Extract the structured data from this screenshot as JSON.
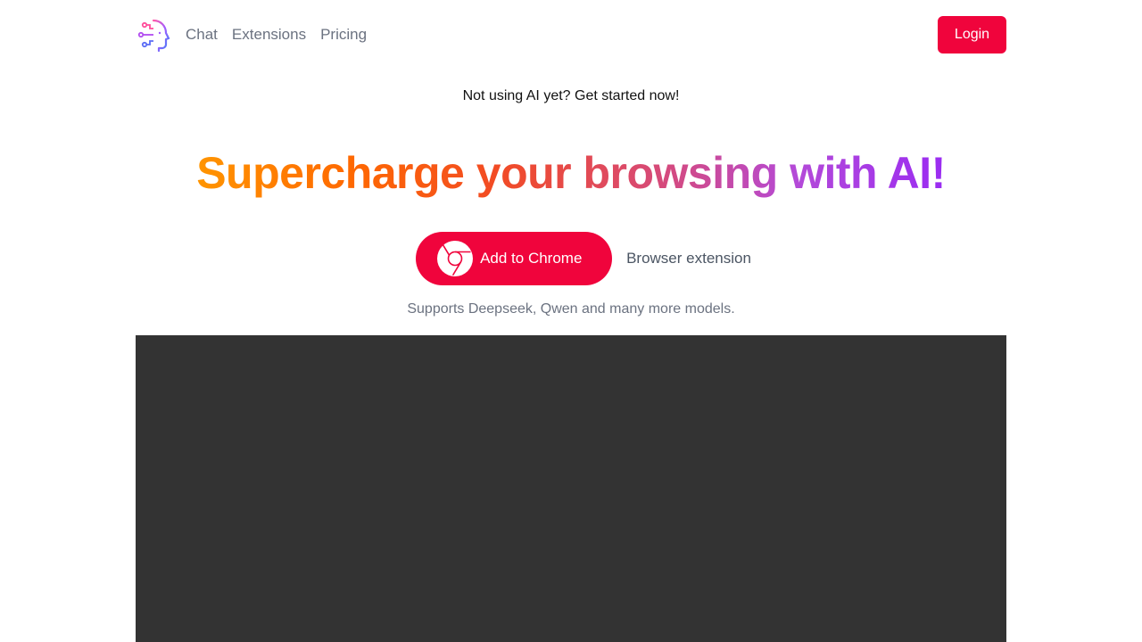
{
  "header": {
    "nav": [
      {
        "label": "Chat"
      },
      {
        "label": "Extensions"
      },
      {
        "label": "Pricing"
      }
    ],
    "login_label": "Login"
  },
  "hero": {
    "tagline": "Not using AI yet? Get started now!",
    "headline": "Supercharge your browsing with AI!",
    "cta_label": "Add to Chrome",
    "secondary_label": "Browser extension",
    "support_text": "Supports Deepseek, Qwen and many more models."
  },
  "colors": {
    "accent": "#f0043c",
    "gradient_start": "#ff9500",
    "gradient_end": "#9a2cf2",
    "media_bg": "#333333"
  },
  "icons": {
    "logo": "ai-head-logo-icon",
    "chrome": "chrome-icon"
  }
}
